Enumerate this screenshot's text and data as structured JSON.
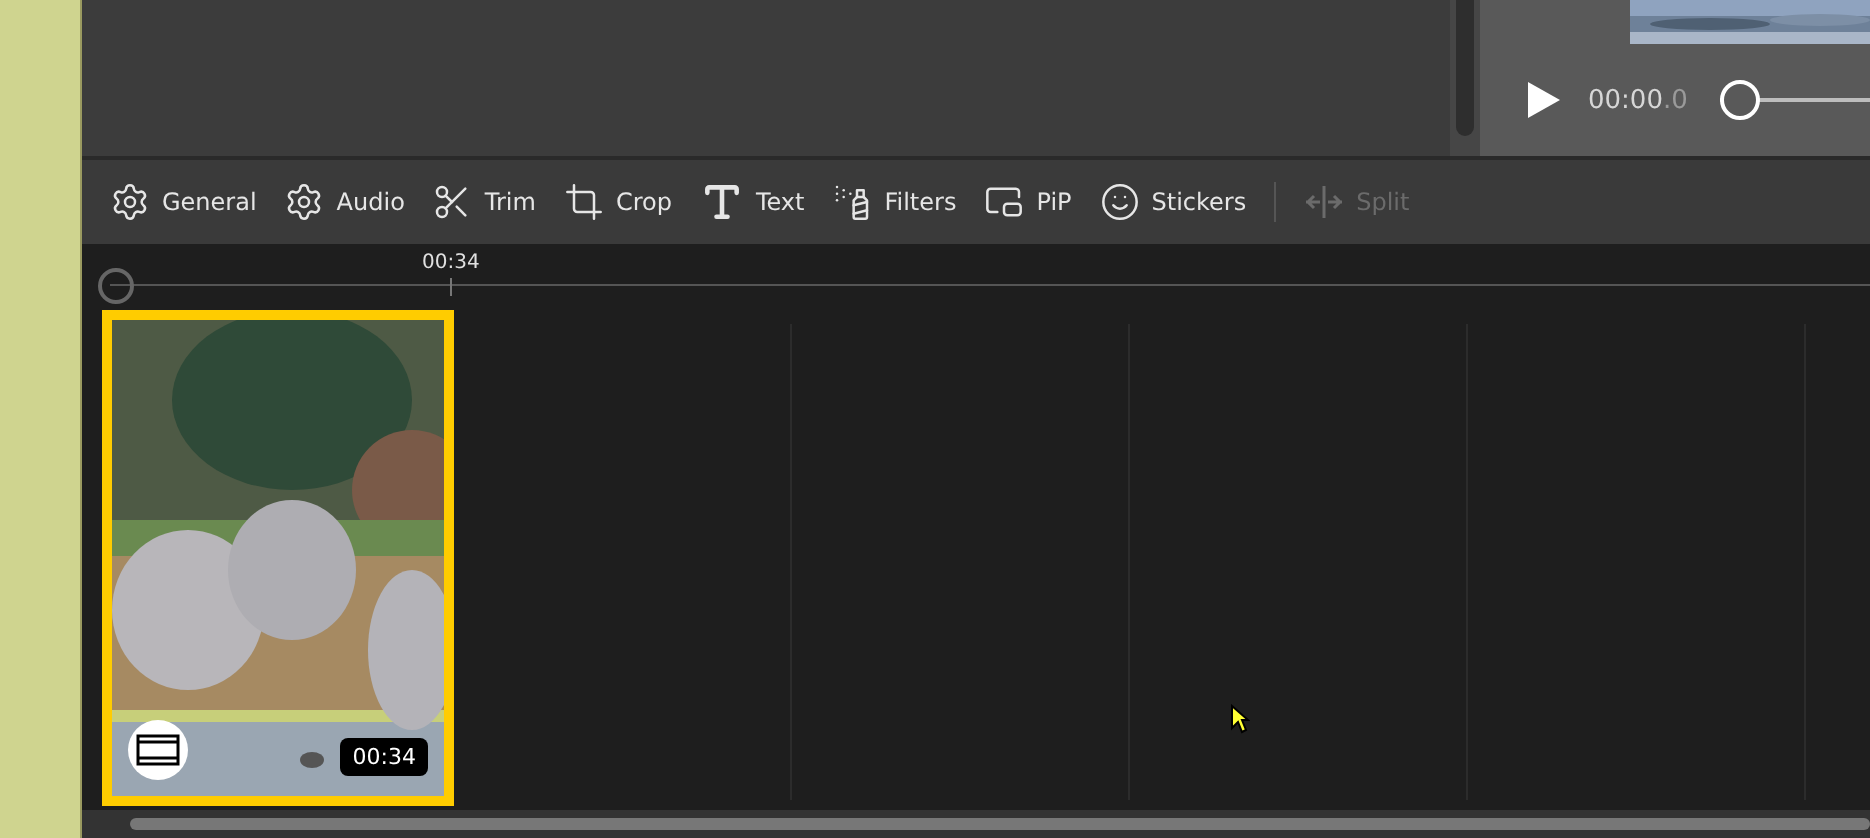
{
  "preview": {
    "kind": "picture",
    "time": "00:00",
    "time_fraction": ".0",
    "seek_slider": {
      "level": 0
    }
  },
  "toolbar": [
    {
      "kind": "general",
      "label": "General",
      "disabled": false
    },
    {
      "kind": "audio",
      "label": "Audio",
      "disabled": false
    },
    {
      "kind": "trim",
      "label": "Trim",
      "disabled": false
    },
    {
      "kind": "crop",
      "label": "Crop",
      "disabled": false
    },
    {
      "kind": "text",
      "label": "Text",
      "disabled": false
    },
    {
      "kind": "filters",
      "label": "Filters",
      "disabled": false
    },
    {
      "kind": "pip",
      "label": "PiP",
      "disabled": false
    },
    {
      "kind": "stickers",
      "label": "Stickers",
      "disabled": false
    },
    {
      "kind": "split",
      "label": "Split",
      "disabled": true
    }
  ],
  "ruler": {
    "marks": [
      "00:34"
    ]
  },
  "timeline": {
    "clips": [
      {
        "kind": "picture",
        "duration": "00:34",
        "selected": true
      }
    ]
  }
}
